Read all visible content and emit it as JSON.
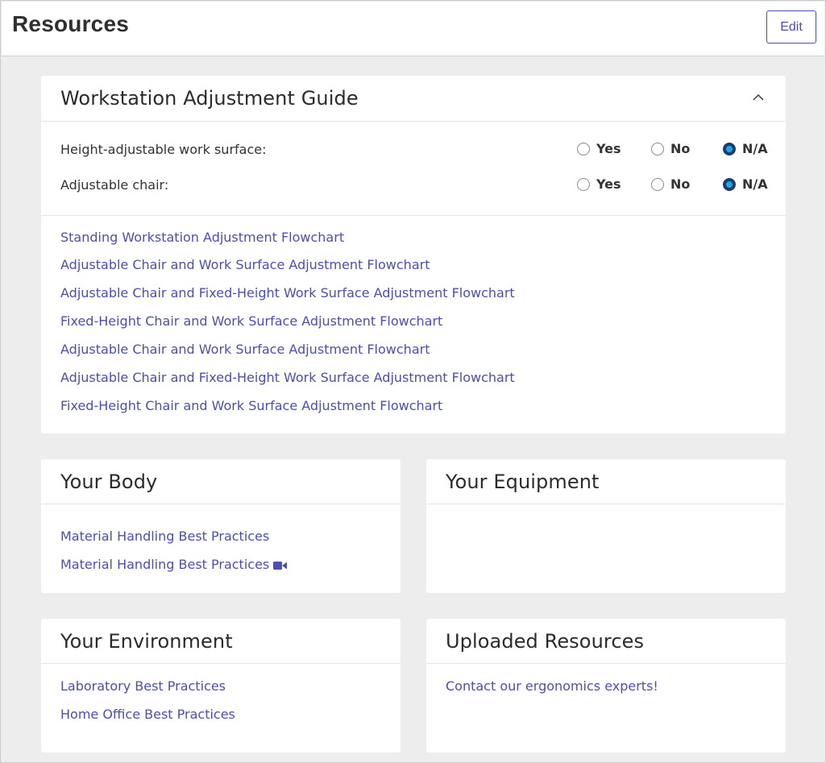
{
  "header": {
    "title": "Resources",
    "edit_label": "Edit"
  },
  "colors": {
    "link": "#4a4fb0",
    "radio_selected_outer": "#1a3c6e",
    "radio_selected_inner": "#20a6df",
    "background": "#ededed"
  },
  "workstation_guide": {
    "title": "Workstation Adjustment Guide",
    "expanded": true,
    "collapse_icon": "chevron-up-icon",
    "questions": [
      {
        "label": "Height-adjustable work surface:",
        "options": [
          "Yes",
          "No",
          "N/A"
        ],
        "selected": "N/A"
      },
      {
        "label": "Adjustable chair:",
        "options": [
          "Yes",
          "No",
          "N/A"
        ],
        "selected": "N/A"
      }
    ],
    "links": [
      "Standing Workstation Adjustment Flowchart",
      "Adjustable Chair and Work Surface Adjustment Flowchart",
      "Adjustable Chair and Fixed-Height Work Surface Adjustment Flowchart",
      "Fixed-Height Chair and Work Surface Adjustment Flowchart",
      "Adjustable Chair and Work Surface Adjustment Flowchart",
      "Adjustable Chair and Fixed-Height Work Surface Adjustment Flowchart",
      "Fixed-Height Chair and Work Surface Adjustment Flowchart"
    ]
  },
  "your_body": {
    "title": "Your Body",
    "links": [
      {
        "label": "Material Handling Best Practices",
        "icon": null
      },
      {
        "label": "Material Handling Best Practices",
        "icon": "video-camera-icon"
      }
    ]
  },
  "your_equipment": {
    "title": "Your Equipment",
    "links": []
  },
  "your_environment": {
    "title": "Your Environment",
    "links": [
      "Laboratory Best Practices",
      "Home Office Best Practices"
    ]
  },
  "uploaded_resources": {
    "title": "Uploaded Resources",
    "links": [
      "Contact our ergonomics experts!"
    ]
  }
}
